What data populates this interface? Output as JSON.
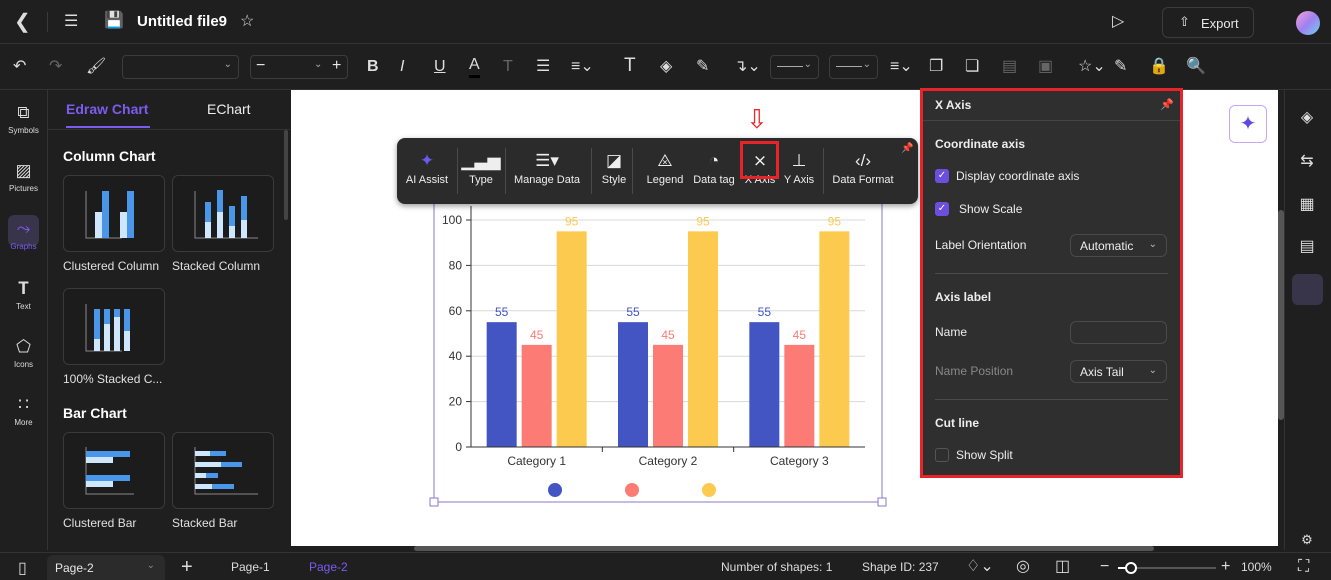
{
  "header": {
    "title": "Untitled file9",
    "export_label": "Export"
  },
  "toolbar": {
    "font_value": "",
    "size_value": ""
  },
  "left_rail": [
    {
      "label": "Symbols",
      "icon": "symbols-icon"
    },
    {
      "label": "Pictures",
      "icon": "pictures-icon"
    },
    {
      "label": "Graphs",
      "icon": "graphs-icon",
      "active": true
    },
    {
      "label": "Text",
      "icon": "text-icon"
    },
    {
      "label": "Icons",
      "icon": "icons-icon"
    },
    {
      "label": "More",
      "icon": "more-icon"
    }
  ],
  "panel": {
    "tabs": [
      {
        "label": "Edraw Chart",
        "active": true
      },
      {
        "label": "EChart"
      }
    ],
    "sections": [
      {
        "title": "Column Chart",
        "items": [
          "Clustered Column",
          "Stacked Column",
          "100% Stacked C..."
        ]
      },
      {
        "title": "Bar Chart",
        "items": [
          "Clustered Bar",
          "Stacked Bar"
        ]
      }
    ]
  },
  "chart_toolbar": [
    "AI Assist",
    "Type",
    "Manage Data",
    "Style",
    "Legend",
    "Data tag",
    "X Axis",
    "Y Axis",
    "Data Format"
  ],
  "xaxis_panel": {
    "title": "X Axis",
    "coord_heading": "Coordinate axis",
    "display_axis": "Display coordinate axis",
    "display_axis_checked": true,
    "show_scale": "Show Scale",
    "show_scale_checked": true,
    "label_orientation": "Label Orientation",
    "label_orientation_value": "Automatic",
    "axis_label_heading": "Axis label",
    "name_label": "Name",
    "name_value": "",
    "name_position": "Name Position",
    "name_position_value": "Axis Tail",
    "cut_line_heading": "Cut line",
    "show_split": "Show Split",
    "show_split_checked": false
  },
  "statusbar": {
    "page_select": "Page-2",
    "pages": [
      "Page-1",
      "Page-2"
    ],
    "active_page": "Page-2",
    "shapes": "Number of shapes: 1",
    "shape_id": "Shape ID: 237",
    "zoom": "100%"
  },
  "colors": {
    "accent": "#7b5cf0",
    "highlight": "#e8232a"
  },
  "chart_data": {
    "type": "bar",
    "categories": [
      "Category 1",
      "Category 2",
      "Category 3"
    ],
    "series": [
      {
        "values": [
          55,
          55,
          55
        ],
        "color": "#4255c3"
      },
      {
        "values": [
          45,
          45,
          45
        ],
        "color": "#fc7b74"
      },
      {
        "values": [
          95,
          95,
          95
        ],
        "color": "#fcca4f"
      }
    ],
    "ylim": [
      0,
      100
    ],
    "yticks": [
      0,
      20,
      40,
      60,
      80,
      100
    ],
    "grid": true,
    "data_labels": true,
    "legend": "bottom"
  }
}
